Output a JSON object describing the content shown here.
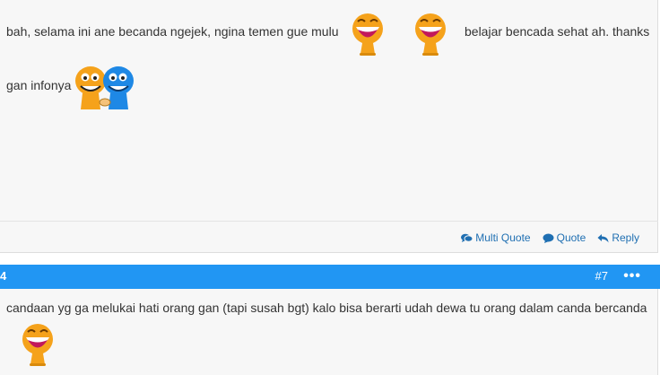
{
  "post1": {
    "text_line1_left": "bah, selama ini ane becanda ngejek, ngina temen gue mulu",
    "text_line1_right": "belajar bencada sehat ah. thanks",
    "text_line2": "gan infonya",
    "emoticons": [
      "laughing-emoticon",
      "laughing-emoticon",
      "handshake-emoticon"
    ]
  },
  "actions": {
    "multi_quote": "Multi Quote",
    "quote": "Quote",
    "reply": "Reply",
    "icons": [
      "comments-icon",
      "comment-icon",
      "reply-arrow-icon"
    ]
  },
  "post2_header": {
    "left_fragment": "4",
    "post_number": "#7",
    "menu": "•••"
  },
  "post2": {
    "text": "candaan yg ga melukai hati orang gan (tapi susah bgt) kalo bisa berarti udah dewa tu orang dalam canda bercanda",
    "emoticons": [
      "laughing-emoticon"
    ]
  },
  "colors": {
    "header_blue": "#2196f3",
    "link_blue": "#1f6fb2",
    "post_background": "#f7f7f7",
    "emoticon_orange": "#f5a21b",
    "emoticon_blue": "#1e88e5"
  }
}
